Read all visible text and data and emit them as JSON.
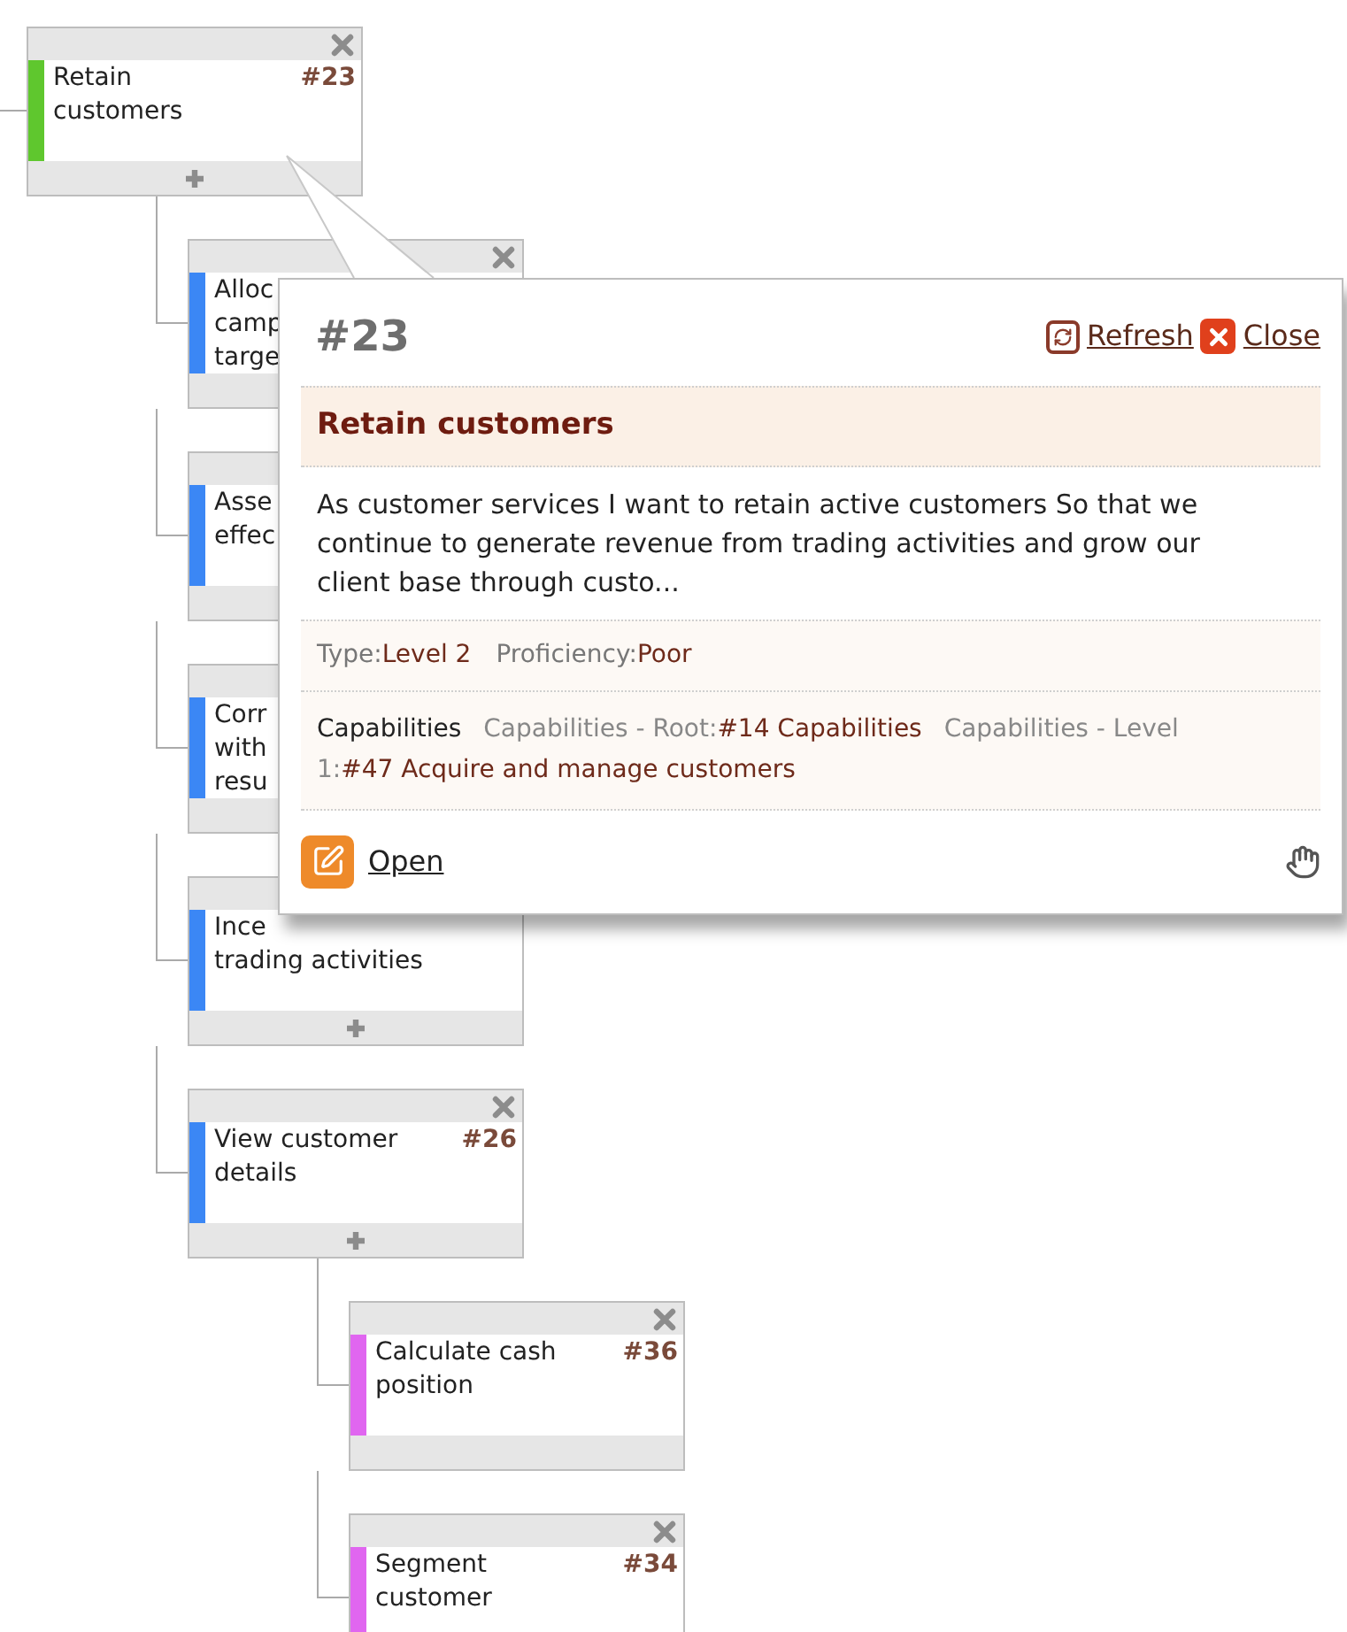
{
  "tree": {
    "title": "Retain customers",
    "number": "#23",
    "color": "#5fc72e",
    "close_icon": true,
    "expandable": true,
    "children": [
      {
        "title": "Alloc\ncamp\ntarge",
        "color": "#3b87f5",
        "close_icon": true
      },
      {
        "title": "Asse\neffec",
        "color": "#3b87f5"
      },
      {
        "title": "Corr\nwith\nresu",
        "color": "#3b87f5"
      },
      {
        "title": "Ince\ntrading activities",
        "color": "#3b87f5",
        "expandable": true
      },
      {
        "title": "View customer details",
        "number": "#26",
        "color": "#3b87f5",
        "close_icon": true,
        "expandable": true,
        "children": [
          {
            "title": "Calculate cash position",
            "number": "#36",
            "color": "#e066f0",
            "close_icon": true,
            "expandable": false
          },
          {
            "title": "Segment customer",
            "number": "#34",
            "color": "#e066f0",
            "close_icon": true,
            "expandable": false
          }
        ]
      }
    ]
  },
  "popup": {
    "number": "#23",
    "refresh": "Refresh",
    "close": "Close",
    "title": "Retain customers",
    "description": "As customer services I want to retain active customers So that we continue to generate revenue from trading activities and grow our client base through custo...",
    "properties": [
      {
        "label": "Type:",
        "value": "Level 2"
      },
      {
        "label": "Proficiency:",
        "value": "Poor"
      }
    ],
    "capabilities": {
      "heading": "Capabilities",
      "items": [
        {
          "label": "Capabilities - Root:",
          "value": "#14 Capabilities"
        },
        {
          "label": "Capabilities - Level 1:",
          "value": "#47 Acquire and manage customers"
        }
      ]
    },
    "open": "Open"
  }
}
